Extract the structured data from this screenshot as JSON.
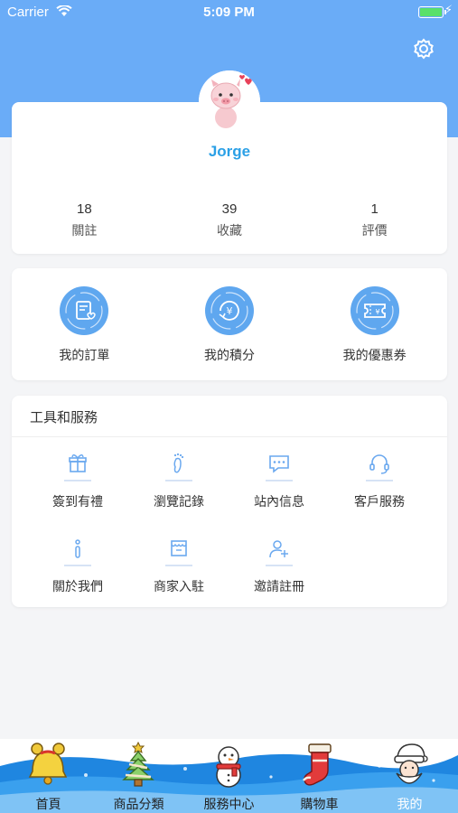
{
  "status_bar": {
    "carrier": "Carrier",
    "time": "5:09 PM"
  },
  "profile": {
    "username": "Jorge",
    "stats": [
      {
        "value": "18",
        "label": "關註"
      },
      {
        "value": "39",
        "label": "收藏"
      },
      {
        "value": "1",
        "label": "評價"
      }
    ]
  },
  "orders": [
    {
      "label": "我的訂單",
      "icon": "order-icon"
    },
    {
      "label": "我的積分",
      "icon": "points-icon"
    },
    {
      "label": "我的優惠券",
      "icon": "coupon-icon"
    }
  ],
  "tools": {
    "title": "工具和服務",
    "items": [
      {
        "label": "簽到有禮",
        "icon": "gift-icon"
      },
      {
        "label": "瀏覽記錄",
        "icon": "footprint-icon"
      },
      {
        "label": "站內信息",
        "icon": "message-icon"
      },
      {
        "label": "客戶服務",
        "icon": "headset-icon"
      },
      {
        "label": "關於我們",
        "icon": "info-icon"
      },
      {
        "label": "商家入駐",
        "icon": "store-icon"
      },
      {
        "label": "邀請註冊",
        "icon": "add-user-icon"
      }
    ]
  },
  "tabbar": {
    "items": [
      {
        "label": "首頁",
        "icon": "bell-icon"
      },
      {
        "label": "商品分類",
        "icon": "christmas-tree-icon"
      },
      {
        "label": "服務中心",
        "icon": "snowman-icon"
      },
      {
        "label": "購物車",
        "icon": "stocking-icon"
      },
      {
        "label": "我的",
        "icon": "santa-icon"
      }
    ],
    "active_index": 4
  },
  "colors": {
    "header": "#6aacf7",
    "accent": "#5fa7ef",
    "username": "#2ba0e6",
    "tabbar_wave": "#1f86e0"
  }
}
